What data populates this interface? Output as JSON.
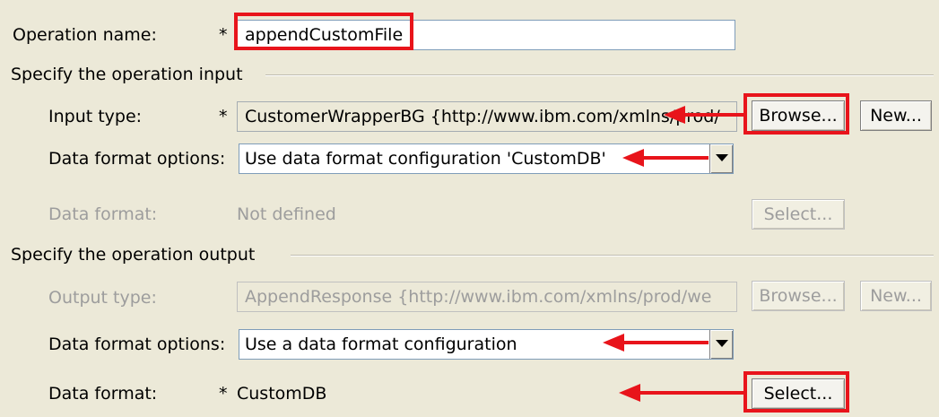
{
  "operation": {
    "label": "Operation name:",
    "required_marker": "*",
    "value": "appendCustomFile"
  },
  "input_section": {
    "title": "Specify the operation input",
    "input_type": {
      "label": "Input type:",
      "required_marker": "*",
      "value": "CustomerWrapperBG  {http://www.ibm.com/xmlns/prod/",
      "browse_label": "Browse...",
      "new_label": "New..."
    },
    "data_format_options": {
      "label": "Data format options:",
      "selected": "Use data format configuration 'CustomDB'"
    },
    "data_format": {
      "label": "Data format:",
      "value": "Not defined",
      "select_label": "Select..."
    }
  },
  "output_section": {
    "title": "Specify the operation output",
    "output_type": {
      "label": "Output type:",
      "value": "AppendResponse  {http://www.ibm.com/xmlns/prod/we",
      "browse_label": "Browse...",
      "new_label": "New..."
    },
    "data_format_options": {
      "label": "Data format options:",
      "selected": "Use a data format configuration"
    },
    "data_format": {
      "label": "Data format:",
      "required_marker": "*",
      "value": "CustomDB",
      "select_label": "Select..."
    }
  },
  "colors": {
    "background": "#ece9d8",
    "highlight": "#e8141b",
    "disabled_text": "#9d9d9d"
  }
}
